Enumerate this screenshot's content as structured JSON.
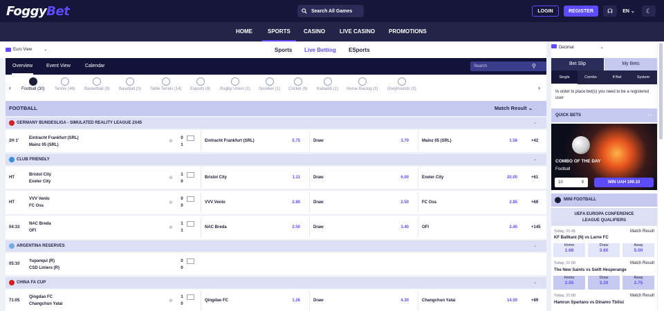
{
  "header": {
    "logo_main": "Foggy",
    "logo_accent": "Bet",
    "search_label": "Search All Games",
    "login": "LOGIN",
    "register": "REGISTER",
    "language": "EN"
  },
  "nav": [
    "HOME",
    "SPORTS",
    "CASINO",
    "LIVE CASINO",
    "PROMOTIONS"
  ],
  "subnav": {
    "view": "Euro View",
    "tabs": [
      "Sports",
      "Live Betting",
      "ESports"
    ]
  },
  "viewtabs": {
    "items": [
      "Overview",
      "Event View",
      "Calendar"
    ],
    "search_placeholder": "Search"
  },
  "sports": [
    "Football (30)",
    "Tennis (46)",
    "Basketball (9)",
    "Baseball (3)",
    "Table Tennis (14)",
    "Esports (8)",
    "Rugby Union (1)",
    "Snooker (1)",
    "Cricket (6)",
    "Kabaddi (1)",
    "Horse Racing (3)",
    "Greyhounds (3)"
  ],
  "football_header": {
    "title": "FOOTBALL",
    "market": "Match Result"
  },
  "leagues": [
    {
      "name": "GERMANY BUNDESLIGA - SIMULATED REALITY LEAGUE 2X45",
      "flag_color": "#d02020"
    },
    {
      "name": "CLUB FRIENDLY",
      "flag_color": "#3a8fd9"
    },
    {
      "name": "ARGENTINA RESERVES",
      "flag_color": "#74acdf"
    },
    {
      "name": "CHINA FA CUP",
      "flag_color": "#d02020"
    }
  ],
  "matches": [
    {
      "time": "2H 1'",
      "home": "Eintracht Frankfurt (SRL)",
      "away": "Mainz 05 (SRL)",
      "s1": "0",
      "s2": "1",
      "o1n": "Eintracht Frankfurt (SRL)",
      "o1": "5.75",
      "o2n": "Draw",
      "o2": "3.70",
      "o3n": "Mainz 05 (SRL)",
      "o3": "1.58",
      "more": "+42"
    },
    {
      "time": "HT",
      "home": "Bristol City",
      "away": "Exeter City",
      "s1": "1",
      "s2": "0",
      "o1n": "Bristol City",
      "o1": "1.11",
      "o2n": "Draw",
      "o2": "6.00",
      "o3n": "Exeter City",
      "o3": "20.00",
      "more": "+61"
    },
    {
      "time": "HT",
      "home": "VVV Venlo",
      "away": "FC Oss",
      "s1": "0",
      "s2": "0",
      "o1n": "VVV Venlo",
      "o1": "2.80",
      "o2n": "Draw",
      "o2": "2.50",
      "o3n": "FC Oss",
      "o3": "2.85",
      "more": "+69"
    },
    {
      "time": "04:33",
      "home": "NAC Breda",
      "away": "OFI",
      "s1": "1",
      "s2": "1",
      "o1n": "NAC Breda",
      "o1": "2.50",
      "o2n": "Draw",
      "o2": "3.40",
      "o3n": "OFI",
      "o3": "2.40",
      "more": "+145"
    },
    {
      "time": "05:10",
      "home": "Yupanqui (R)",
      "away": "CSD Liniers (R)",
      "s1": "0",
      "s2": "0"
    },
    {
      "time": "71:05",
      "home": "Qingdao FC",
      "away": "Changchun Yatai",
      "s1": "1",
      "s2": "0",
      "o1n": "Qingdao FC",
      "o1": "1.26",
      "o2n": "Draw",
      "o2": "4.30",
      "o3n": "Changchun Yatai",
      "o3": "14.50",
      "more": "+89"
    }
  ],
  "betslip": {
    "odds_format": "Decimal",
    "tabs": [
      "Bet Slip",
      "My Bets"
    ],
    "types": [
      "Single",
      "Combo",
      "If Bet",
      "System"
    ],
    "note": "In order to place bet(s) you need to be a registered user"
  },
  "quick_bets": {
    "title": "QUICK BETS",
    "promo_title": "COMBO OF THE DAY",
    "promo_sport": "Football",
    "stake": "10",
    "win_label": "WIN UAH 199.10"
  },
  "mini_football": {
    "title": "MINI FOOTBALL",
    "league": "UEFA EUROPA CONFERENCE LEAGUE QUALIFIERS",
    "matches": [
      {
        "date": "Today, 21:45",
        "market": "Match Result",
        "teams": "KF Ballkani (N) vs Larne FC",
        "home": "1.68",
        "draw": "3.60",
        "away": "5.00"
      },
      {
        "date": "Today, 21:00",
        "market": "Match Result",
        "teams": "The New Saints vs Swift Hesperange",
        "home": "2.55",
        "draw": "3.20",
        "away": "2.75"
      },
      {
        "date": "Today, 21:00",
        "market": "Match Result",
        "teams": "Hamrun Spartans vs Dinamo Tbilisi"
      }
    ],
    "labels": {
      "home": "Home",
      "draw": "Draw",
      "away": "Away"
    }
  }
}
